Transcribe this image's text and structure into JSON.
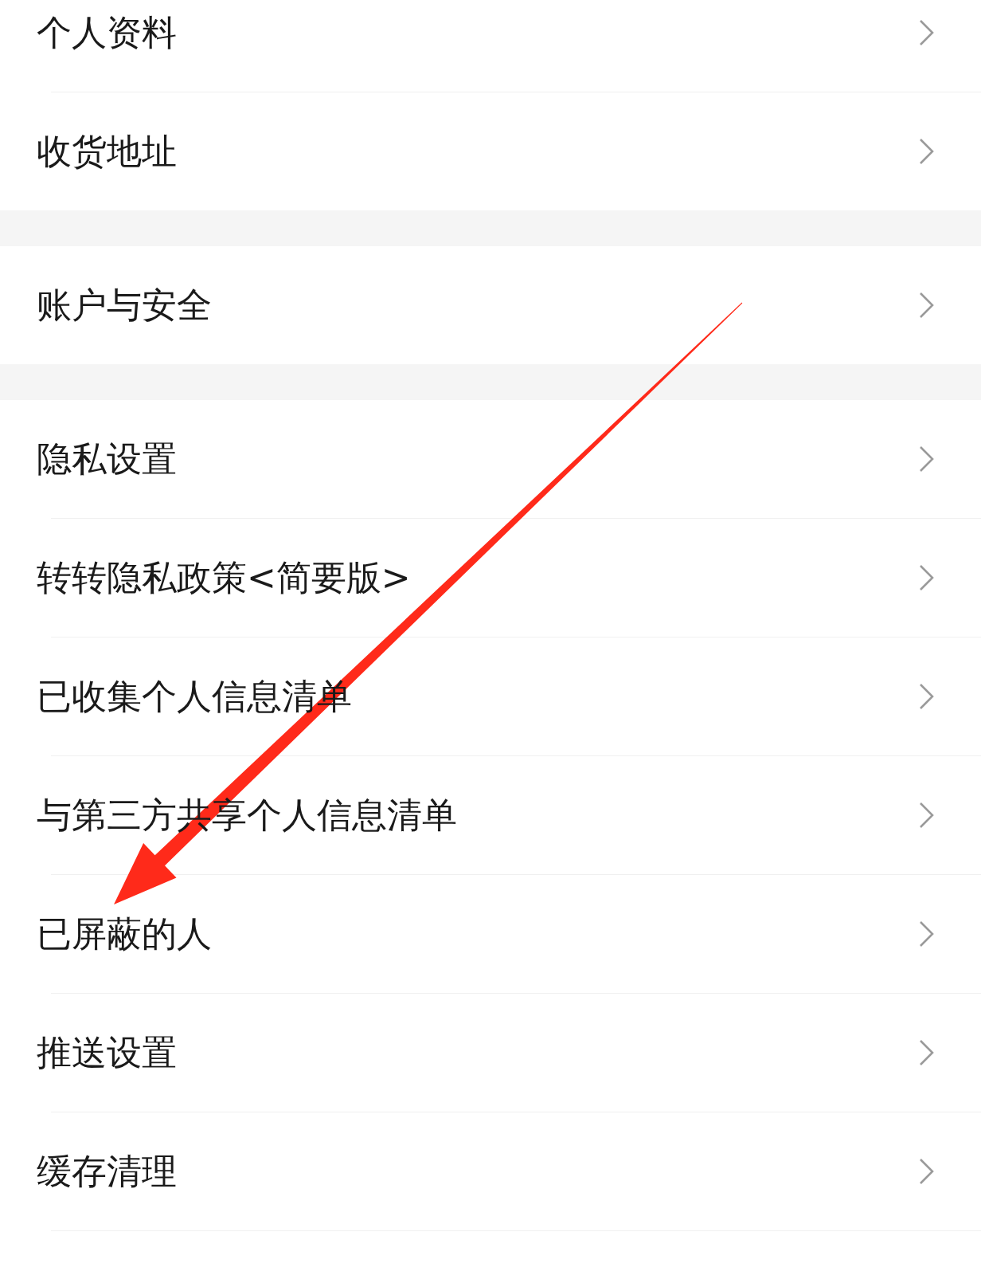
{
  "sections": [
    {
      "items": [
        {
          "label": "个人资料"
        },
        {
          "label": "收货地址"
        }
      ]
    },
    {
      "items": [
        {
          "label": "账户与安全"
        }
      ]
    },
    {
      "items": [
        {
          "label": "隐私设置"
        },
        {
          "label": "转转隐私政策<简要版>"
        },
        {
          "label": "已收集个人信息清单"
        },
        {
          "label": "与第三方共享个人信息清单"
        },
        {
          "label": "已屏蔽的人"
        },
        {
          "label": "推送设置"
        },
        {
          "label": "缓存清理"
        }
      ]
    }
  ],
  "annotation": {
    "kind": "arrow"
  }
}
